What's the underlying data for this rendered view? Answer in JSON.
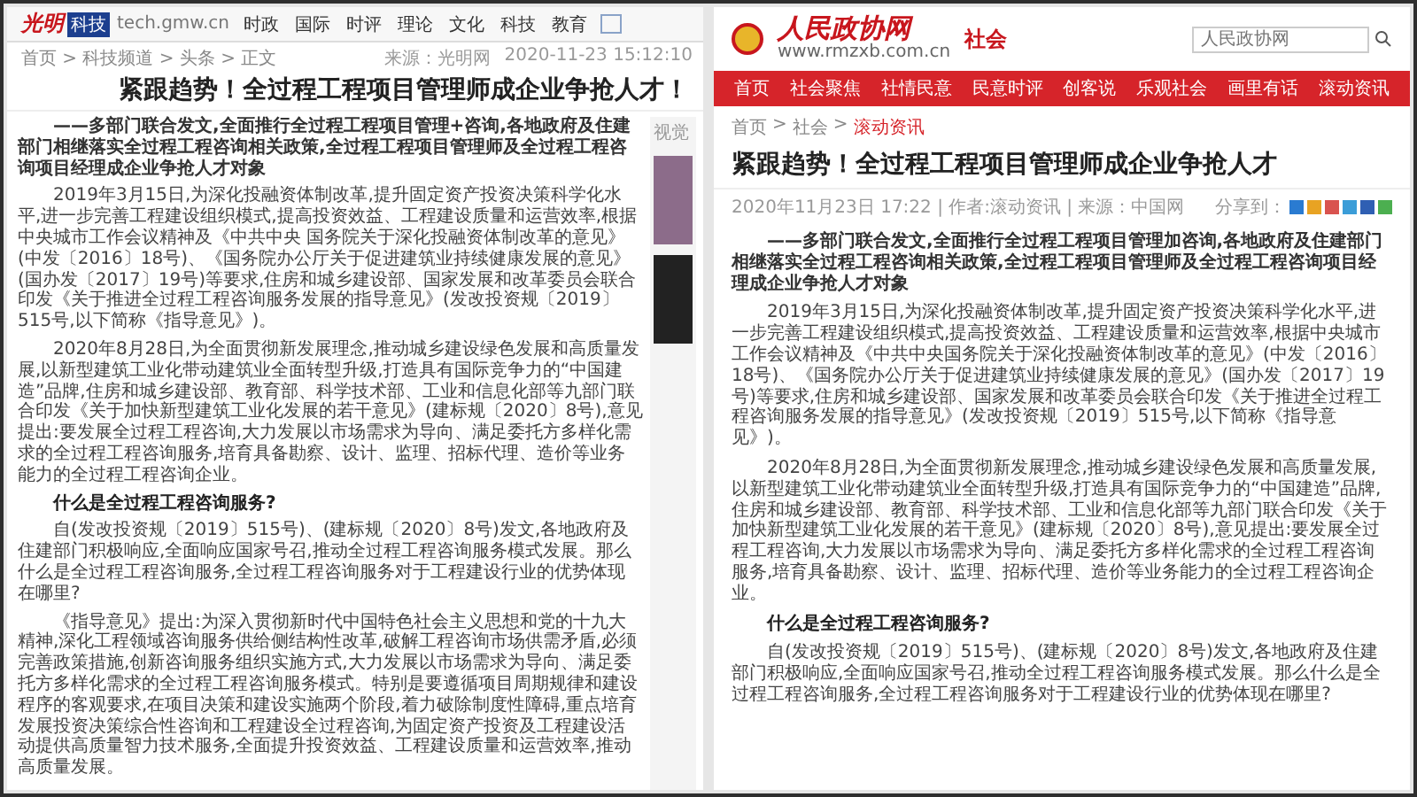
{
  "left_page": {
    "logo": {
      "name": "光明",
      "badge": "科技",
      "domain": "tech.gmw.cn"
    },
    "nav": [
      "时政",
      "国际",
      "时评",
      "理论",
      "文化",
      "科技",
      "教育"
    ],
    "breadcrumb": "首页 > 科技频道 > 头条 > 正文",
    "title": "紧跟趋势！全过程工程项目管理师成企业争抢人才！",
    "source": "来源：光明网",
    "time": "2020-11-23 15:12:10",
    "sidebar_heading": "视觉",
    "paragraphs": [
      {
        "kind": "lede",
        "text": "——多部门联合发文,全面推行全过程工程项目管理+咨询,各地政府及住建部门相继落实全过程工程咨询相关政策,全过程工程项目管理师及全过程工程咨询项目经理成企业争抢人才对象"
      },
      {
        "kind": "body",
        "text": "2019年3月15日,为深化投融资体制改革,提升固定资产投资决策科学化水平,进一步完善工程建设组织模式,提高投资效益、工程建设质量和运营效率,根据中央城市工作会议精神及《中共中央 国务院关于深化投融资体制改革的意见》(中发〔2016〕18号)、《国务院办公厅关于促进建筑业持续健康发展的意见》(国办发〔2017〕19号)等要求,住房和城乡建设部、国家发展和改革委员会联合印发《关于推进全过程工程咨询服务发展的指导意见》(发改投资规〔2019〕515号,以下简称《指导意见》)。"
      },
      {
        "kind": "body",
        "text": "2020年8月28日,为全面贯彻新发展理念,推动城乡建设绿色发展和高质量发展,以新型建筑工业化带动建筑业全面转型升级,打造具有国际竞争力的“中国建造”品牌,住房和城乡建设部、教育部、科学技术部、工业和信息化部等九部门联合印发《关于加快新型建筑工业化发展的若干意见》(建标规〔2020〕8号),意见提出:要发展全过程工程咨询,大力发展以市场需求为导向、满足委托方多样化需求的全过程工程咨询服务,培育具备勘察、设计、监理、招标代理、造价等业务能力的全过程工程咨询企业。"
      },
      {
        "kind": "heading",
        "text": "什么是全过程工程咨询服务?"
      },
      {
        "kind": "body",
        "text": "自(发改投资规〔2019〕515号)、(建标规〔2020〕8号)发文,各地政府及住建部门积极响应,全面响应国家号召,推动全过程工程咨询服务模式发展。那么什么是全过程工程咨询服务,全过程工程咨询服务对于工程建设行业的优势体现在哪里?"
      },
      {
        "kind": "body",
        "text": "《指导意见》提出:为深入贯彻新时代中国特色社会主义思想和党的十九大精神,深化工程领域咨询服务供给侧结构性改革,破解工程咨询市场供需矛盾,必须完善政策措施,创新咨询服务组织实施方式,大力发展以市场需求为导向、满足委托方多样化需求的全过程工程咨询服务模式。特别是要遵循项目周期规律和建设程序的客观要求,在项目决策和建设实施两个阶段,着力破除制度性障碍,重点培育发展投资决策综合性咨询和工程建设全过程咨询,为固定资产投资及工程建设活动提供高质量智力技术服务,全面提升投资效益、工程建设质量和运营效率,推动高质量发展。"
      }
    ]
  },
  "right_page": {
    "logo": {
      "name": "人民政协网",
      "domain": "www.rmzxb.com.cn",
      "channel": "社会"
    },
    "search": {
      "placeholder": "人民政协网"
    },
    "nav": [
      "首页",
      "社会聚焦",
      "社情民意",
      "民意时评",
      "创客说",
      "乐观社会",
      "画里有话",
      "滚动资讯"
    ],
    "breadcrumb_separator": ">",
    "breadcrumb": [
      {
        "text": "首页",
        "selected": false
      },
      {
        "text": "社会",
        "selected": false
      },
      {
        "text": "滚动资讯",
        "selected": true
      }
    ],
    "title": "紧跟趋势！全过程工程项目管理师成企业争抢人才",
    "meta": "2020年11月23日 17:22 | 作者:滚动资讯 | 来源：中国网",
    "share_label": "分享到：",
    "share_buttons": [
      {
        "color": "#2a7bd1"
      },
      {
        "color": "#e8a323"
      },
      {
        "color": "#d9534f"
      },
      {
        "color": "#3b9dd8"
      },
      {
        "color": "#2f5fb3"
      },
      {
        "color": "#4caf50"
      }
    ],
    "paragraphs": [
      {
        "kind": "lede",
        "text": "——多部门联合发文,全面推行全过程工程项目管理加咨询,各地政府及住建部门相继落实全过程工程咨询相关政策,全过程工程项目管理师及全过程工程咨询项目经理成企业争抢人才对象"
      },
      {
        "kind": "body",
        "text": "2019年3月15日,为深化投融资体制改革,提升固定资产投资决策科学化水平,进一步完善工程建设组织模式,提高投资效益、工程建设质量和运营效率,根据中央城市工作会议精神及《中共中央国务院关于深化投融资体制改革的意见》(中发〔2016〕18号)、《国务院办公厅关于促进建筑业持续健康发展的意见》(国办发〔2017〕19号)等要求,住房和城乡建设部、国家发展和改革委员会联合印发《关于推进全过程工程咨询服务发展的指导意见》(发改投资规〔2019〕515号,以下简称《指导意见》)。"
      },
      {
        "kind": "body",
        "text": "2020年8月28日,为全面贯彻新发展理念,推动城乡建设绿色发展和高质量发展,以新型建筑工业化带动建筑业全面转型升级,打造具有国际竞争力的“中国建造”品牌,住房和城乡建设部、教育部、科学技术部、工业和信息化部等九部门联合印发《关于加快新型建筑工业化发展的若干意见》(建标规〔2020〕8号),意见提出:要发展全过程工程咨询,大力发展以市场需求为导向、满足委托方多样化需求的全过程工程咨询服务,培育具备勘察、设计、监理、招标代理、造价等业务能力的全过程工程咨询企业。"
      },
      {
        "kind": "heading",
        "text": "什么是全过程工程咨询服务?"
      },
      {
        "kind": "body",
        "text": "自(发改投资规〔2019〕515号)、(建标规〔2020〕8号)发文,各地政府及住建部门积极响应,全面响应国家号召,推动全过程工程咨询服务模式发展。那么什么是全过程工程咨询服务,全过程工程咨询服务对于工程建设行业的优势体现在哪里?"
      }
    ]
  }
}
